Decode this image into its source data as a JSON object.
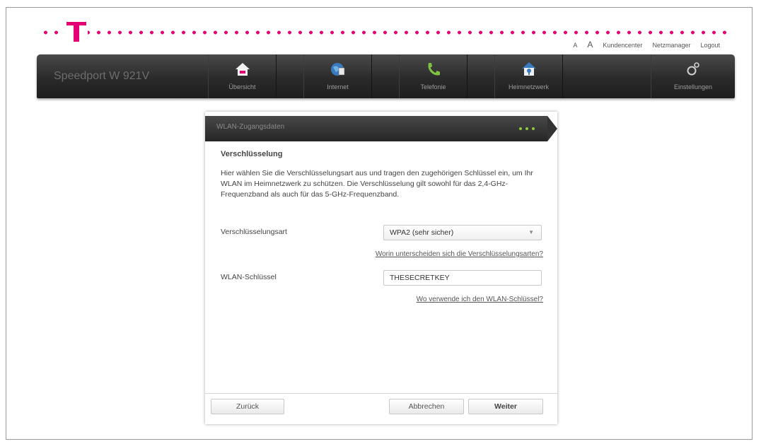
{
  "header": {
    "font_small": "A",
    "font_large": "A",
    "links": [
      "Kundencenter",
      "Netzmanager",
      "Logout"
    ],
    "brand_color": "#e20074"
  },
  "navbar": {
    "model": "Speedport W 921V",
    "items": [
      {
        "label": "Übersicht",
        "icon": "home-icon"
      },
      {
        "label": "Internet",
        "icon": "globe-icon"
      },
      {
        "label": "Telefonie",
        "icon": "phone-icon"
      },
      {
        "label": "Heimnetzwerk",
        "icon": "home-network-icon"
      },
      {
        "label": "Einstellungen",
        "icon": "settings-icon"
      }
    ]
  },
  "wizard": {
    "header_title": "WLAN-Zugangsdaten",
    "section_title": "Verschlüsselung",
    "intro": "Hier wählen Sie die Verschlüsselungsart aus und tragen den zugehörigen Schlüssel ein, um Ihr WLAN im Heimnetzwerk zu schützen. Die Verschlüsselung gilt sowohl für das 2,4-GHz-Frequenzband als auch für das 5-GHz-Frequenzband.",
    "encryption_label": "Verschlüsselungsart",
    "encryption_value": "WPA2 (sehr sicher)",
    "encryption_help_link": "Worin unterscheiden sich die Verschlüsselungsarten?",
    "key_label": "WLAN-Schlüssel",
    "key_value": "THESECRETKEY",
    "key_help_link": "Wo verwende ich den WLAN-Schlüssel?",
    "buttons": {
      "back": "Zurück",
      "cancel": "Abbrechen",
      "next": "Weiter"
    },
    "progress_dot_color": "#8fc93a"
  }
}
